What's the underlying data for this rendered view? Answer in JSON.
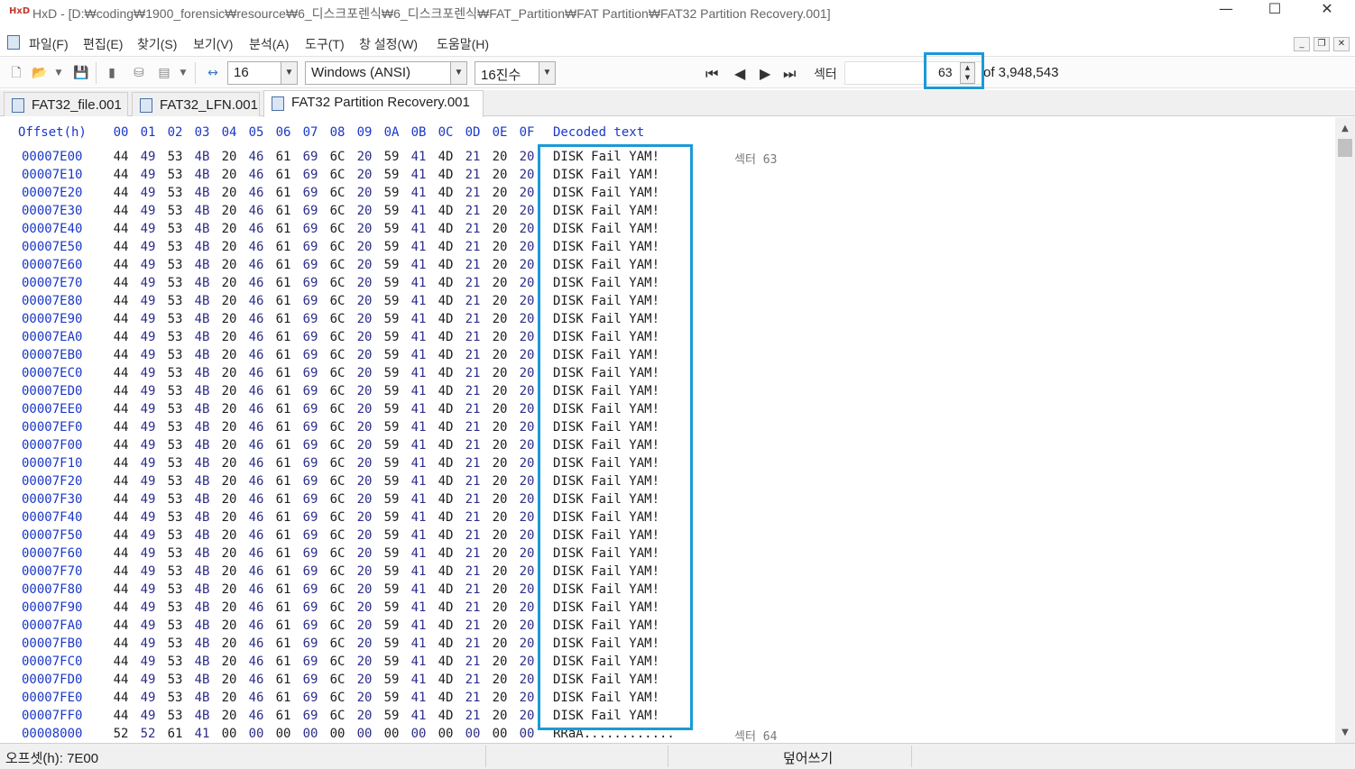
{
  "window": {
    "app_name": "HxD",
    "title": "HxD - [D:₩coding₩1900_forensic₩resource₩6_디스크포렌식₩6_디스크포렌식₩FAT_Partition₩FAT Partition₩FAT32 Partition Recovery.001]",
    "minimize": "—",
    "maximize": "☐",
    "close": "✕"
  },
  "menu": {
    "items": [
      "파일(F)",
      "편집(E)",
      "찾기(S)",
      "보기(V)",
      "분석(A)",
      "도구(T)",
      "창 설정(W)",
      "도움말(H)"
    ],
    "mdi_minimize": "_",
    "mdi_restore": "❐",
    "mdi_close": "✕"
  },
  "toolbar": {
    "bytes_per_row": "16",
    "charset": "Windows (ANSI)",
    "offset_base": "16진수",
    "sector_label": "섹터",
    "sector_value": "63",
    "sector_total": "of 3,948,543",
    "icons": [
      "new-file-icon",
      "open-file-icon",
      "save-icon",
      "close-file-icon",
      "disk-icon",
      "ram-icon",
      "bytes-per-row-icon",
      "first-sector-icon",
      "prev-sector-icon",
      "next-sector-icon",
      "last-sector-icon"
    ]
  },
  "tabs": [
    "FAT32_file.001",
    "FAT32_LFN.001",
    "FAT32 Partition Recovery.001"
  ],
  "active_tab": 2,
  "editor": {
    "header_offset": "Offset(h)",
    "header_columns": [
      "00",
      "01",
      "02",
      "03",
      "04",
      "05",
      "06",
      "07",
      "08",
      "09",
      "0A",
      "0B",
      "0C",
      "0D",
      "0E",
      "0F"
    ],
    "header_decoded": "Decoded text",
    "rows": [
      {
        "offset": "00007E00",
        "bytes": [
          "44",
          "49",
          "53",
          "4B",
          "20",
          "46",
          "61",
          "69",
          "6C",
          "20",
          "59",
          "41",
          "4D",
          "21",
          "20",
          "20"
        ],
        "text": "DISK Fail YAM!",
        "sector_note": "섹터 63"
      },
      {
        "offset": "00007E10",
        "bytes": [
          "44",
          "49",
          "53",
          "4B",
          "20",
          "46",
          "61",
          "69",
          "6C",
          "20",
          "59",
          "41",
          "4D",
          "21",
          "20",
          "20"
        ],
        "text": "DISK Fail YAM!"
      },
      {
        "offset": "00007E20",
        "bytes": [
          "44",
          "49",
          "53",
          "4B",
          "20",
          "46",
          "61",
          "69",
          "6C",
          "20",
          "59",
          "41",
          "4D",
          "21",
          "20",
          "20"
        ],
        "text": "DISK Fail YAM!"
      },
      {
        "offset": "00007E30",
        "bytes": [
          "44",
          "49",
          "53",
          "4B",
          "20",
          "46",
          "61",
          "69",
          "6C",
          "20",
          "59",
          "41",
          "4D",
          "21",
          "20",
          "20"
        ],
        "text": "DISK Fail YAM!"
      },
      {
        "offset": "00007E40",
        "bytes": [
          "44",
          "49",
          "53",
          "4B",
          "20",
          "46",
          "61",
          "69",
          "6C",
          "20",
          "59",
          "41",
          "4D",
          "21",
          "20",
          "20"
        ],
        "text": "DISK Fail YAM!"
      },
      {
        "offset": "00007E50",
        "bytes": [
          "44",
          "49",
          "53",
          "4B",
          "20",
          "46",
          "61",
          "69",
          "6C",
          "20",
          "59",
          "41",
          "4D",
          "21",
          "20",
          "20"
        ],
        "text": "DISK Fail YAM!"
      },
      {
        "offset": "00007E60",
        "bytes": [
          "44",
          "49",
          "53",
          "4B",
          "20",
          "46",
          "61",
          "69",
          "6C",
          "20",
          "59",
          "41",
          "4D",
          "21",
          "20",
          "20"
        ],
        "text": "DISK Fail YAM!"
      },
      {
        "offset": "00007E70",
        "bytes": [
          "44",
          "49",
          "53",
          "4B",
          "20",
          "46",
          "61",
          "69",
          "6C",
          "20",
          "59",
          "41",
          "4D",
          "21",
          "20",
          "20"
        ],
        "text": "DISK Fail YAM!"
      },
      {
        "offset": "00007E80",
        "bytes": [
          "44",
          "49",
          "53",
          "4B",
          "20",
          "46",
          "61",
          "69",
          "6C",
          "20",
          "59",
          "41",
          "4D",
          "21",
          "20",
          "20"
        ],
        "text": "DISK Fail YAM!"
      },
      {
        "offset": "00007E90",
        "bytes": [
          "44",
          "49",
          "53",
          "4B",
          "20",
          "46",
          "61",
          "69",
          "6C",
          "20",
          "59",
          "41",
          "4D",
          "21",
          "20",
          "20"
        ],
        "text": "DISK Fail YAM!"
      },
      {
        "offset": "00007EA0",
        "bytes": [
          "44",
          "49",
          "53",
          "4B",
          "20",
          "46",
          "61",
          "69",
          "6C",
          "20",
          "59",
          "41",
          "4D",
          "21",
          "20",
          "20"
        ],
        "text": "DISK Fail YAM!"
      },
      {
        "offset": "00007EB0",
        "bytes": [
          "44",
          "49",
          "53",
          "4B",
          "20",
          "46",
          "61",
          "69",
          "6C",
          "20",
          "59",
          "41",
          "4D",
          "21",
          "20",
          "20"
        ],
        "text": "DISK Fail YAM!"
      },
      {
        "offset": "00007EC0",
        "bytes": [
          "44",
          "49",
          "53",
          "4B",
          "20",
          "46",
          "61",
          "69",
          "6C",
          "20",
          "59",
          "41",
          "4D",
          "21",
          "20",
          "20"
        ],
        "text": "DISK Fail YAM!"
      },
      {
        "offset": "00007ED0",
        "bytes": [
          "44",
          "49",
          "53",
          "4B",
          "20",
          "46",
          "61",
          "69",
          "6C",
          "20",
          "59",
          "41",
          "4D",
          "21",
          "20",
          "20"
        ],
        "text": "DISK Fail YAM!"
      },
      {
        "offset": "00007EE0",
        "bytes": [
          "44",
          "49",
          "53",
          "4B",
          "20",
          "46",
          "61",
          "69",
          "6C",
          "20",
          "59",
          "41",
          "4D",
          "21",
          "20",
          "20"
        ],
        "text": "DISK Fail YAM!"
      },
      {
        "offset": "00007EF0",
        "bytes": [
          "44",
          "49",
          "53",
          "4B",
          "20",
          "46",
          "61",
          "69",
          "6C",
          "20",
          "59",
          "41",
          "4D",
          "21",
          "20",
          "20"
        ],
        "text": "DISK Fail YAM!"
      },
      {
        "offset": "00007F00",
        "bytes": [
          "44",
          "49",
          "53",
          "4B",
          "20",
          "46",
          "61",
          "69",
          "6C",
          "20",
          "59",
          "41",
          "4D",
          "21",
          "20",
          "20"
        ],
        "text": "DISK Fail YAM!"
      },
      {
        "offset": "00007F10",
        "bytes": [
          "44",
          "49",
          "53",
          "4B",
          "20",
          "46",
          "61",
          "69",
          "6C",
          "20",
          "59",
          "41",
          "4D",
          "21",
          "20",
          "20"
        ],
        "text": "DISK Fail YAM!"
      },
      {
        "offset": "00007F20",
        "bytes": [
          "44",
          "49",
          "53",
          "4B",
          "20",
          "46",
          "61",
          "69",
          "6C",
          "20",
          "59",
          "41",
          "4D",
          "21",
          "20",
          "20"
        ],
        "text": "DISK Fail YAM!"
      },
      {
        "offset": "00007F30",
        "bytes": [
          "44",
          "49",
          "53",
          "4B",
          "20",
          "46",
          "61",
          "69",
          "6C",
          "20",
          "59",
          "41",
          "4D",
          "21",
          "20",
          "20"
        ],
        "text": "DISK Fail YAM!"
      },
      {
        "offset": "00007F40",
        "bytes": [
          "44",
          "49",
          "53",
          "4B",
          "20",
          "46",
          "61",
          "69",
          "6C",
          "20",
          "59",
          "41",
          "4D",
          "21",
          "20",
          "20"
        ],
        "text": "DISK Fail YAM!"
      },
      {
        "offset": "00007F50",
        "bytes": [
          "44",
          "49",
          "53",
          "4B",
          "20",
          "46",
          "61",
          "69",
          "6C",
          "20",
          "59",
          "41",
          "4D",
          "21",
          "20",
          "20"
        ],
        "text": "DISK Fail YAM!"
      },
      {
        "offset": "00007F60",
        "bytes": [
          "44",
          "49",
          "53",
          "4B",
          "20",
          "46",
          "61",
          "69",
          "6C",
          "20",
          "59",
          "41",
          "4D",
          "21",
          "20",
          "20"
        ],
        "text": "DISK Fail YAM!"
      },
      {
        "offset": "00007F70",
        "bytes": [
          "44",
          "49",
          "53",
          "4B",
          "20",
          "46",
          "61",
          "69",
          "6C",
          "20",
          "59",
          "41",
          "4D",
          "21",
          "20",
          "20"
        ],
        "text": "DISK Fail YAM!"
      },
      {
        "offset": "00007F80",
        "bytes": [
          "44",
          "49",
          "53",
          "4B",
          "20",
          "46",
          "61",
          "69",
          "6C",
          "20",
          "59",
          "41",
          "4D",
          "21",
          "20",
          "20"
        ],
        "text": "DISK Fail YAM!"
      },
      {
        "offset": "00007F90",
        "bytes": [
          "44",
          "49",
          "53",
          "4B",
          "20",
          "46",
          "61",
          "69",
          "6C",
          "20",
          "59",
          "41",
          "4D",
          "21",
          "20",
          "20"
        ],
        "text": "DISK Fail YAM!"
      },
      {
        "offset": "00007FA0",
        "bytes": [
          "44",
          "49",
          "53",
          "4B",
          "20",
          "46",
          "61",
          "69",
          "6C",
          "20",
          "59",
          "41",
          "4D",
          "21",
          "20",
          "20"
        ],
        "text": "DISK Fail YAM!"
      },
      {
        "offset": "00007FB0",
        "bytes": [
          "44",
          "49",
          "53",
          "4B",
          "20",
          "46",
          "61",
          "69",
          "6C",
          "20",
          "59",
          "41",
          "4D",
          "21",
          "20",
          "20"
        ],
        "text": "DISK Fail YAM!"
      },
      {
        "offset": "00007FC0",
        "bytes": [
          "44",
          "49",
          "53",
          "4B",
          "20",
          "46",
          "61",
          "69",
          "6C",
          "20",
          "59",
          "41",
          "4D",
          "21",
          "20",
          "20"
        ],
        "text": "DISK Fail YAM!"
      },
      {
        "offset": "00007FD0",
        "bytes": [
          "44",
          "49",
          "53",
          "4B",
          "20",
          "46",
          "61",
          "69",
          "6C",
          "20",
          "59",
          "41",
          "4D",
          "21",
          "20",
          "20"
        ],
        "text": "DISK Fail YAM!"
      },
      {
        "offset": "00007FE0",
        "bytes": [
          "44",
          "49",
          "53",
          "4B",
          "20",
          "46",
          "61",
          "69",
          "6C",
          "20",
          "59",
          "41",
          "4D",
          "21",
          "20",
          "20"
        ],
        "text": "DISK Fail YAM!"
      },
      {
        "offset": "00007FF0",
        "bytes": [
          "44",
          "49",
          "53",
          "4B",
          "20",
          "46",
          "61",
          "69",
          "6C",
          "20",
          "59",
          "41",
          "4D",
          "21",
          "20",
          "20"
        ],
        "text": "DISK Fail YAM!"
      },
      {
        "offset": "00008000",
        "bytes": [
          "52",
          "52",
          "61",
          "41",
          "00",
          "00",
          "00",
          "00",
          "00",
          "00",
          "00",
          "00",
          "00",
          "00",
          "00",
          "00"
        ],
        "text": "RRaA............",
        "sector_note": "섹터 64"
      }
    ]
  },
  "status": {
    "offset": "오프셋(h): 7E00",
    "mode": "덮어쓰기"
  },
  "colors": {
    "highlight": "#1a9ad6",
    "offset_text": "#1a38c8"
  }
}
